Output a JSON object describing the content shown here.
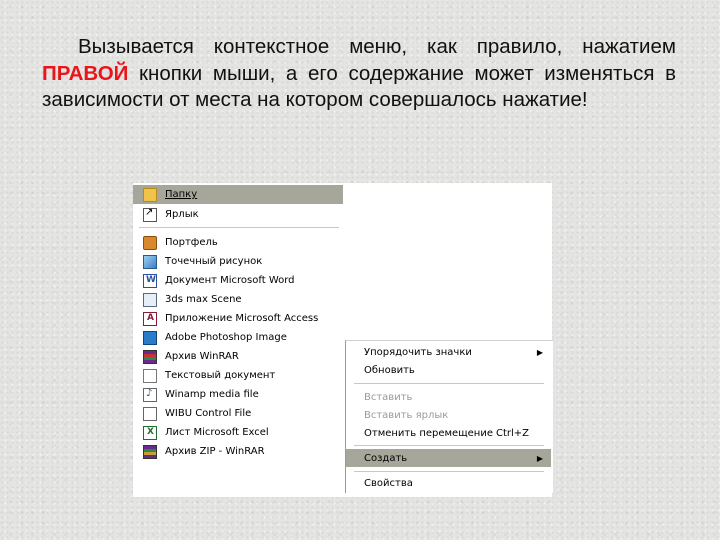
{
  "slide": {
    "text_before": "Вызывается контекстное меню, как правило, нажатием ",
    "text_highlight": "ПРАВОЙ",
    "text_after": " кнопки мыши, а его содержание может изменяться в зависимости от места на котором совершалось нажатие!",
    "highlight_color": "#e8161b"
  },
  "submenu": {
    "items": [
      {
        "label": "Папку",
        "icon": "folder-icon",
        "selected": true
      },
      {
        "label": "Ярлык",
        "icon": "shortcut-icon"
      },
      {
        "label": "Портфель",
        "icon": "briefcase-icon"
      },
      {
        "label": "Точечный рисунок",
        "icon": "bitmap-icon"
      },
      {
        "label": "Документ Microsoft Word",
        "icon": "word-document-icon"
      },
      {
        "label": "3ds max Scene",
        "icon": "3ds-max-icon"
      },
      {
        "label": "Приложение Microsoft Access",
        "icon": "access-icon"
      },
      {
        "label": "Adobe Photoshop Image",
        "icon": "photoshop-icon"
      },
      {
        "label": "Архив WinRAR",
        "icon": "winrar-icon"
      },
      {
        "label": "Текстовый документ",
        "icon": "text-document-icon"
      },
      {
        "label": "Winamp media file",
        "icon": "winamp-icon"
      },
      {
        "label": "WIBU Control File",
        "icon": "wibu-icon"
      },
      {
        "label": "Лист Microsoft Excel",
        "icon": "excel-icon"
      },
      {
        "label": "Архив ZIP - WinRAR",
        "icon": "zip-archive-icon"
      }
    ]
  },
  "context_menu": {
    "arrange_icons": "Упорядочить значки",
    "refresh": "Обновить",
    "paste": "Вставить",
    "paste_shortcut": "Вставить ярлык",
    "undo_move": "Отменить перемещение",
    "undo_shortcut": "Ctrl+Z",
    "new": "Создать",
    "properties": "Свойства",
    "selection_color": "#a6a69a"
  }
}
